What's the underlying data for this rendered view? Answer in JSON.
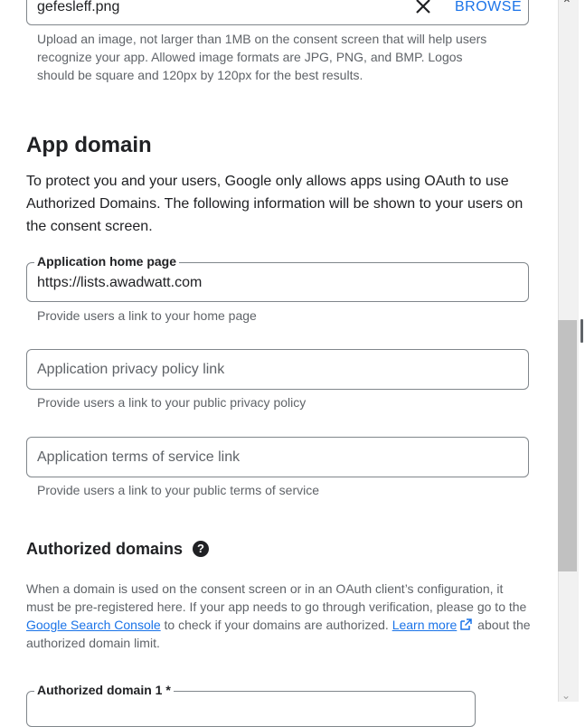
{
  "logo": {
    "filename": "gefesleff.png",
    "browse_label": "BROWSE",
    "hint": "Upload an image, not larger than 1MB on the consent screen that will help users recognize your app. Allowed image formats are JPG, PNG, and BMP. Logos should be square and 120px by 120px for the best results."
  },
  "app_domain": {
    "title": "App domain",
    "description": "To protect you and your users, Google only allows apps using OAuth to use Authorized Domains. The following information will be shown to your users on the consent screen.",
    "home_page": {
      "label": "Application home page",
      "value": "https://lists.awadwatt.com",
      "hint": "Provide users a link to your home page"
    },
    "privacy": {
      "placeholder": "Application privacy policy link",
      "hint": "Provide users a link to your public privacy policy"
    },
    "terms": {
      "placeholder": "Application terms of service link",
      "hint": "Provide users a link to your public terms of service"
    }
  },
  "authorized_domains": {
    "title": "Authorized domains",
    "help_icon": "?",
    "text_1": "When a domain is used on the consent screen or in an OAuth client’s configuration, it must be pre-registered here. If your app needs to go through verification, please go to the ",
    "link_search_console": "Google Search Console",
    "text_2": " to check if your domains are authorized. ",
    "link_learn_more": "Learn more",
    "text_3": " about the authorized domain limit.",
    "domain_1_label": "Authorized domain 1 *"
  },
  "icons": {
    "clear": "close-icon",
    "external": "external-link-icon",
    "help": "help-icon"
  },
  "colors": {
    "link": "#1a73e8",
    "text": "#202124",
    "secondary_text": "#5f6368",
    "border": "#80868b"
  }
}
